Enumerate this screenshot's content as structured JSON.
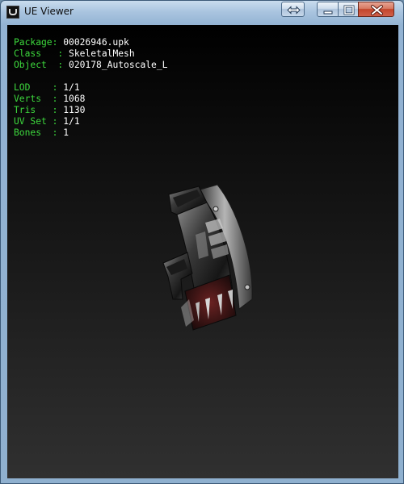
{
  "window": {
    "title": "UE Viewer",
    "buttons": [
      "resize",
      "minimize",
      "maximize",
      "close"
    ]
  },
  "info": {
    "package_label": "Package",
    "package_value": "00026946.upk",
    "class_label": "Class",
    "class_value": "SkeletalMesh",
    "object_label": "Object",
    "object_value": "020178_Autoscale_L",
    "lod_label": "LOD",
    "lod_value": "1/1",
    "verts_label": "Verts",
    "verts_value": "1068",
    "tris_label": "Tris",
    "tris_value": "1130",
    "uvset_label": "UV Set",
    "uvset_value": "1/1",
    "bones_label": "Bones",
    "bones_value": "1"
  },
  "colors": {
    "label": "#3dd93d",
    "value": "#ffffff",
    "background_top": "#000000",
    "background_bottom": "#303030"
  },
  "icons": {
    "app": "ue-logo-icon",
    "resize": "double-arrow-icon",
    "minimize": "minimize-icon",
    "maximize": "maximize-icon",
    "close": "close-icon"
  }
}
